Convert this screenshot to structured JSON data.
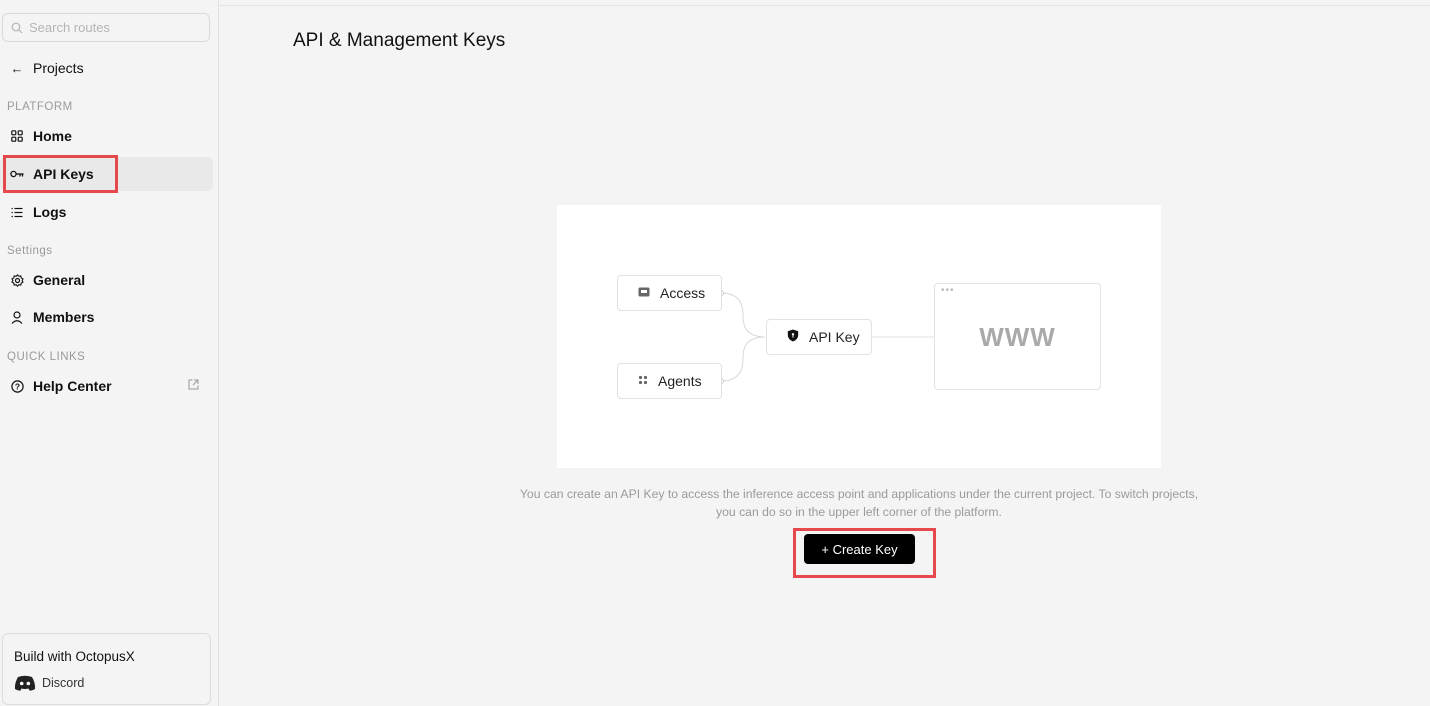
{
  "sidebar": {
    "search": {
      "placeholder": "Search routes",
      "value": ""
    },
    "back": {
      "label": "Projects",
      "icon": "arrow-left-icon"
    },
    "sections": {
      "platform": "PLATFORM",
      "settings": "Settings",
      "quick_links": "QUICK LINKS"
    },
    "items": [
      {
        "label": "Home",
        "icon": "grid-icon"
      },
      {
        "label": "API Keys",
        "icon": "key-icon",
        "active": true
      },
      {
        "label": "Logs",
        "icon": "list-icon"
      },
      {
        "label": "General",
        "icon": "gear-icon"
      },
      {
        "label": "Members",
        "icon": "user-icon"
      },
      {
        "label": "Help Center",
        "icon": "help-circle-icon",
        "external": true
      }
    ],
    "build": {
      "title": "Build with OctopusX",
      "discord_label": "Discord"
    }
  },
  "main": {
    "title": "API & Management Keys",
    "illustration": {
      "access_label": "Access",
      "agents_label": "Agents",
      "api_key_label": "API Key",
      "browser_text": "WWW"
    },
    "description_line1": "You can create an API Key to access the inference access point and applications under the current project. To switch projects,",
    "description_line2": "you can do so in the upper left corner of the platform.",
    "create_button": "+ Create Key"
  },
  "colors": {
    "background": "#f4f4f4",
    "highlight": "#e5484d",
    "button": "#000000"
  }
}
